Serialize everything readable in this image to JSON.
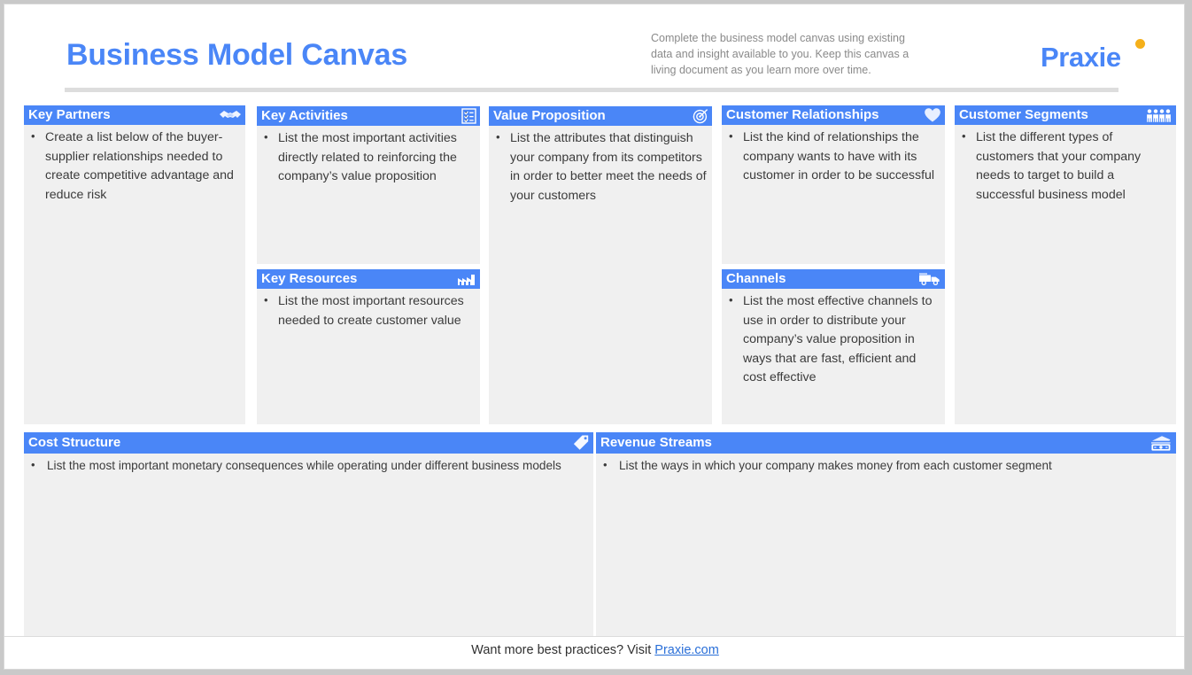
{
  "header": {
    "title": "Business Model Canvas",
    "note": "Complete the business model canvas using existing data and insight available to you. Keep this canvas a living document as you learn more over time.",
    "brand": "Praxie",
    "brand_accent_color": "#f5b01a",
    "title_color": "#4a86f7"
  },
  "theme": {
    "header_blue": "#4a86f7",
    "panel_fill": "#f0f0f0",
    "text_color": "#3b3b3b",
    "page_background": "#ffffff",
    "outer_background": "#c9c9c9",
    "rule_color": "#dddddd",
    "link_color": "#2a6fd8"
  },
  "panels": {
    "key_partners": {
      "title": "Key Partners",
      "icon": "handshake-icon",
      "bullets": [
        "Create a list below of the buyer-supplier relationships needed to create competitive advantage and reduce risk"
      ]
    },
    "key_activities": {
      "title": "Key Activities",
      "icon": "checklist-icon",
      "bullets": [
        "List the most important activities directly related to reinforcing the company’s value proposition"
      ]
    },
    "key_resources": {
      "title": "Key Resources",
      "icon": "factory-icon",
      "bullets": [
        "List the most important resources needed to create customer value"
      ]
    },
    "value_proposition": {
      "title": "Value Proposition",
      "icon": "target-icon",
      "bullets": [
        "List the attributes that distinguish your company from its competitors in order to better meet the needs of your customers"
      ]
    },
    "customer_relationships": {
      "title": "Customer Relationships",
      "icon": "heart-icon",
      "bullets": [
        "List the kind of relationships the company wants to have with its customer in order to be successful"
      ]
    },
    "channels": {
      "title": "Channels",
      "icon": "delivery-truck-icon",
      "bullets": [
        "List the most effective channels to use in order to distribute your company’s value proposition in ways that are fast, efficient and cost effective"
      ]
    },
    "customer_segments": {
      "title": "Customer Segments",
      "icon": "people-group-icon",
      "bullets": [
        "List the different types of customers that your company needs to target to build a successful business model"
      ]
    },
    "cost_structure": {
      "title": "Cost Structure",
      "icon": "price-tag-icon",
      "bullets": [
        "List the most important monetary consequences while operating under different business models"
      ]
    },
    "revenue_streams": {
      "title": "Revenue Streams",
      "icon": "money-cash-icon",
      "bullets": [
        "List the ways in which your company makes money from each customer segment"
      ]
    }
  },
  "footer": {
    "text": "Want more best practices? Visit ",
    "link": "Praxie.com"
  }
}
